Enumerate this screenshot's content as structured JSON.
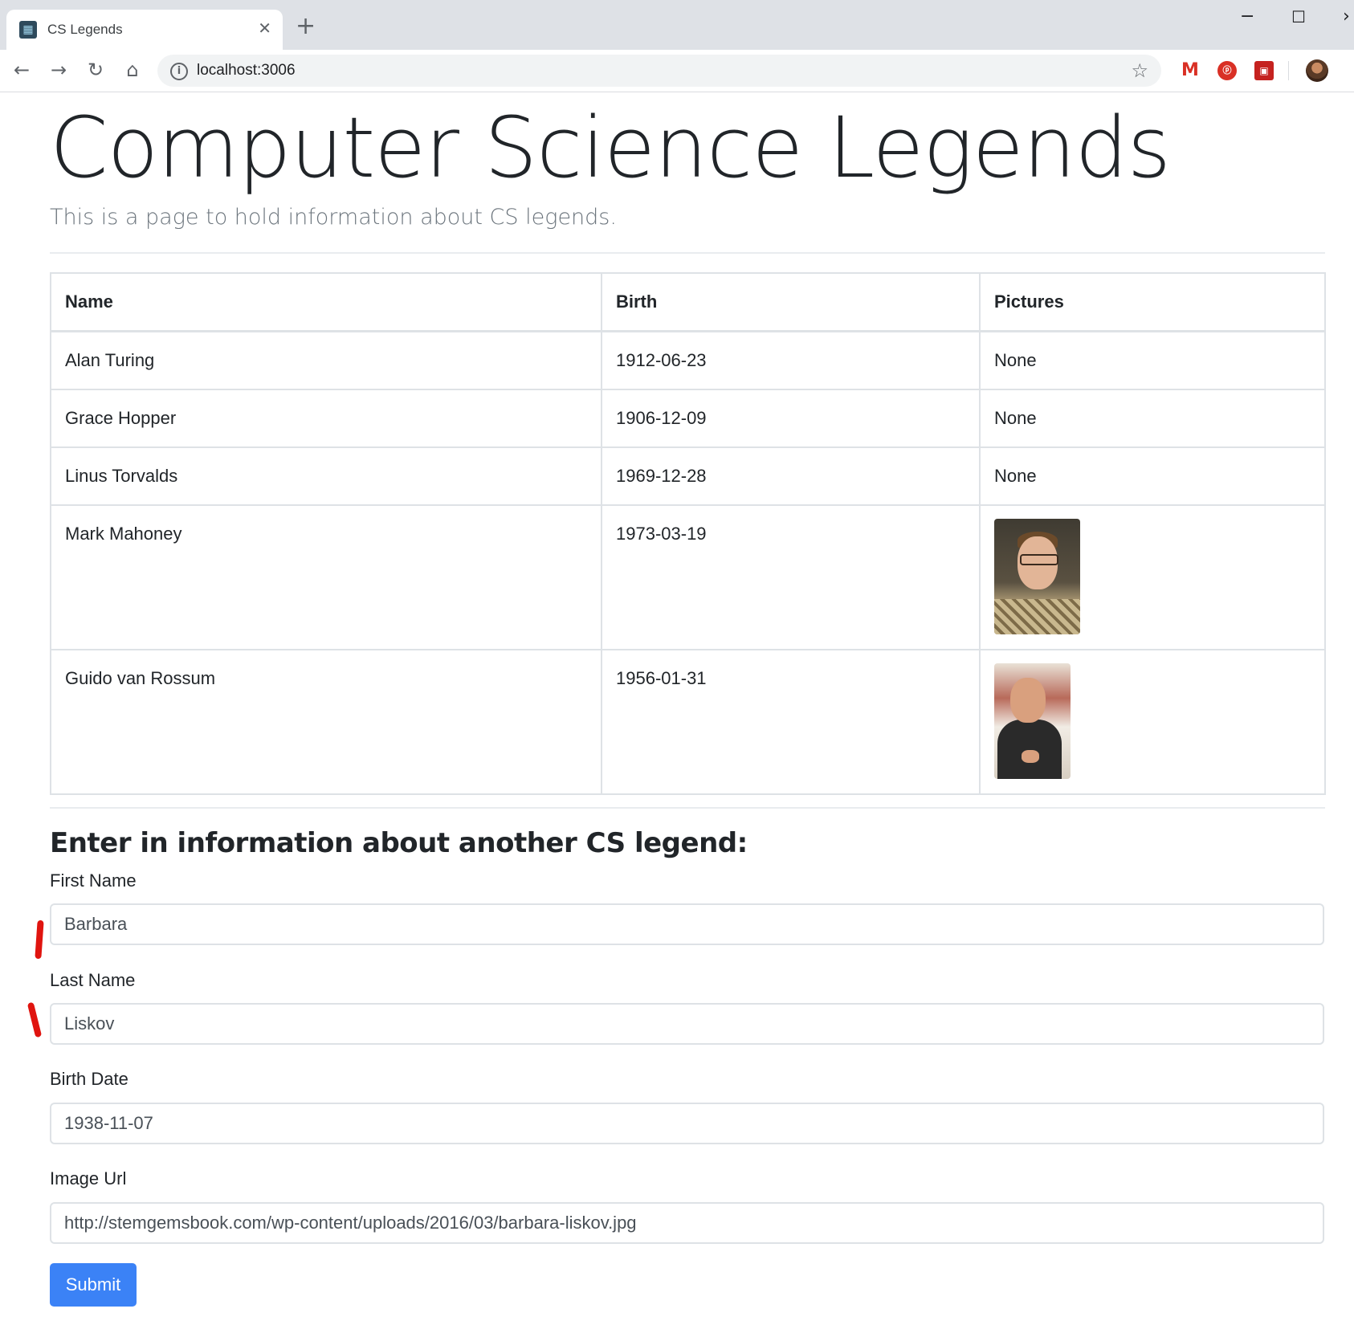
{
  "browser": {
    "tab_title": "CS Legends",
    "tab_close": "✕",
    "new_tab": "+",
    "url": "localhost:3006",
    "icons": [
      "back-icon",
      "forward-icon",
      "reload-icon",
      "home-icon",
      "site-info-icon",
      "bookmark-star-icon",
      "gmail-icon",
      "extension-icon",
      "pdf-icon",
      "profile-avatar",
      "menu-icon",
      "minimize-icon",
      "maximize-icon",
      "close-window-icon"
    ]
  },
  "page": {
    "title": "Computer Science Legends",
    "lead": "This is a page to hold information about CS legends."
  },
  "table": {
    "headers": [
      "Name",
      "Birth",
      "Pictures"
    ],
    "rows": [
      {
        "name": "Alan Turing",
        "birth": "1912-06-23",
        "picture": "None"
      },
      {
        "name": "Grace Hopper",
        "birth": "1906-12-09",
        "picture": "None"
      },
      {
        "name": "Linus Torvalds",
        "birth": "1969-12-28",
        "picture": "None"
      },
      {
        "name": "Mark Mahoney",
        "birth": "1973-03-19",
        "picture": "photo"
      },
      {
        "name": "Guido van Rossum",
        "birth": "1956-01-31",
        "picture": "photo"
      }
    ]
  },
  "form": {
    "heading": "Enter in information about another CS legend:",
    "first_name_label": "First Name",
    "first_name_value": "Barbara",
    "last_name_label": "Last Name",
    "last_name_value": "Liskov",
    "birth_date_label": "Birth Date",
    "birth_date_value": "1938-11-07",
    "image_url_label": "Image Url",
    "image_url_value": "http://stemgemsbook.com/wp-content/uploads/2016/03/barbara-liskov.jpg",
    "submit_label": "Submit"
  },
  "colors": {
    "primary_button": "#3b82f6",
    "annotation_marks": "#e0140f"
  }
}
